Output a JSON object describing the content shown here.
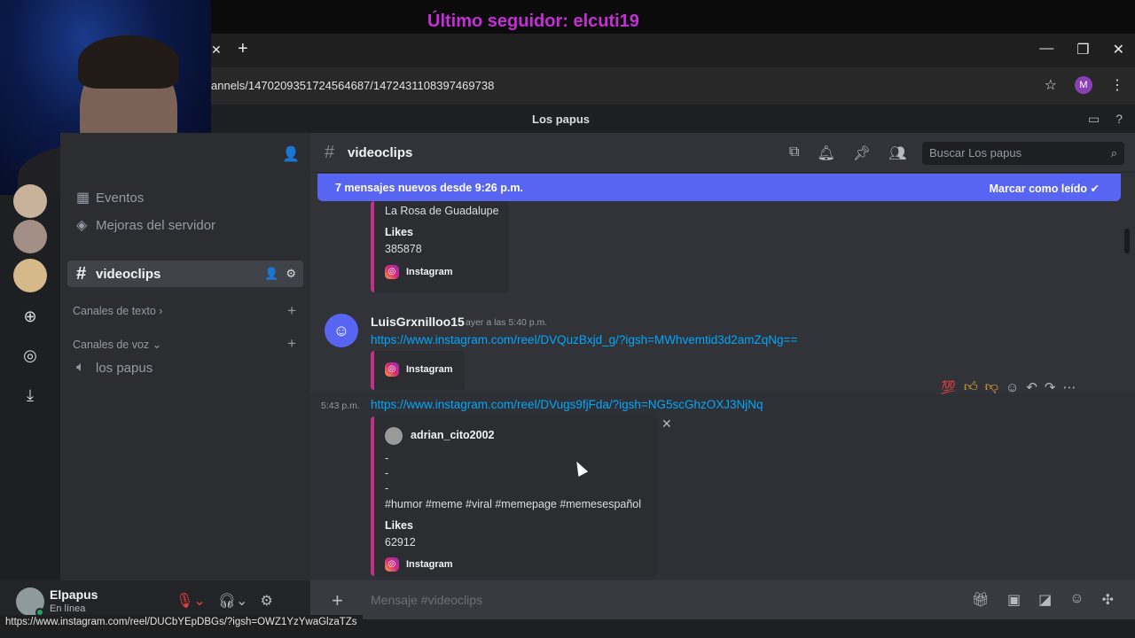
{
  "overlay": {
    "text": "Último seguidor: elcuti19"
  },
  "browser": {
    "url": "annels/1470209351724564687/1472431108397469738",
    "profile_initial": "M",
    "status_url": "https://www.instagram.com/reel/DUCbYEpDBGs/?igsh=OWZ1YzYwaGlzaTZs"
  },
  "server": {
    "name": "Los papus"
  },
  "sidebar": {
    "items": [
      {
        "label": "Eventos"
      },
      {
        "label": "Mejoras del servidor"
      },
      {
        "label": "videoclips"
      }
    ],
    "categories": [
      {
        "label": "Canales de texto"
      },
      {
        "label": "Canales de voz"
      }
    ],
    "voice_channels": [
      {
        "label": "los papus"
      }
    ]
  },
  "user": {
    "name": "Elpapus",
    "status": "En línea"
  },
  "channel": {
    "name": "videoclips",
    "search_placeholder": "Buscar Los papus",
    "new_banner": "7 mensajes nuevos desde 9:26 p.m.",
    "mark_read": "Marcar como leído",
    "input_placeholder": "Mensaje #videoclips"
  },
  "messages": {
    "embed1": {
      "line": "La Rosa de Guadalupe",
      "likes_label": "Likes",
      "likes": "385878",
      "provider": "Instagram"
    },
    "msg1": {
      "user": "LuisGrxnilloo15",
      "time": "ayer a las 5:40 p.m.",
      "link": "https://www.instagram.com/reel/DVQuzBxjd_g/?igsh=MWhvemtid3d2amZqNg==",
      "provider": "Instagram"
    },
    "msg2": {
      "time": "5:43 p.m.",
      "link": "https://www.instagram.com/reel/DVugs9fjFda/?igsh=NG5scGhzOXJ3NjNq",
      "author": "adrian_cito2002",
      "lines": [
        "-",
        "-",
        "-"
      ],
      "hashtags": "#humor #meme #viral #memepage #memesespañol",
      "likes_label": "Likes",
      "likes": "62912",
      "provider": "Instagram"
    }
  },
  "colors": {
    "accent": "#5865f2",
    "link": "#00a8fc",
    "embed_border": "#c1318c",
    "overlay_text": "#c52fd6"
  }
}
